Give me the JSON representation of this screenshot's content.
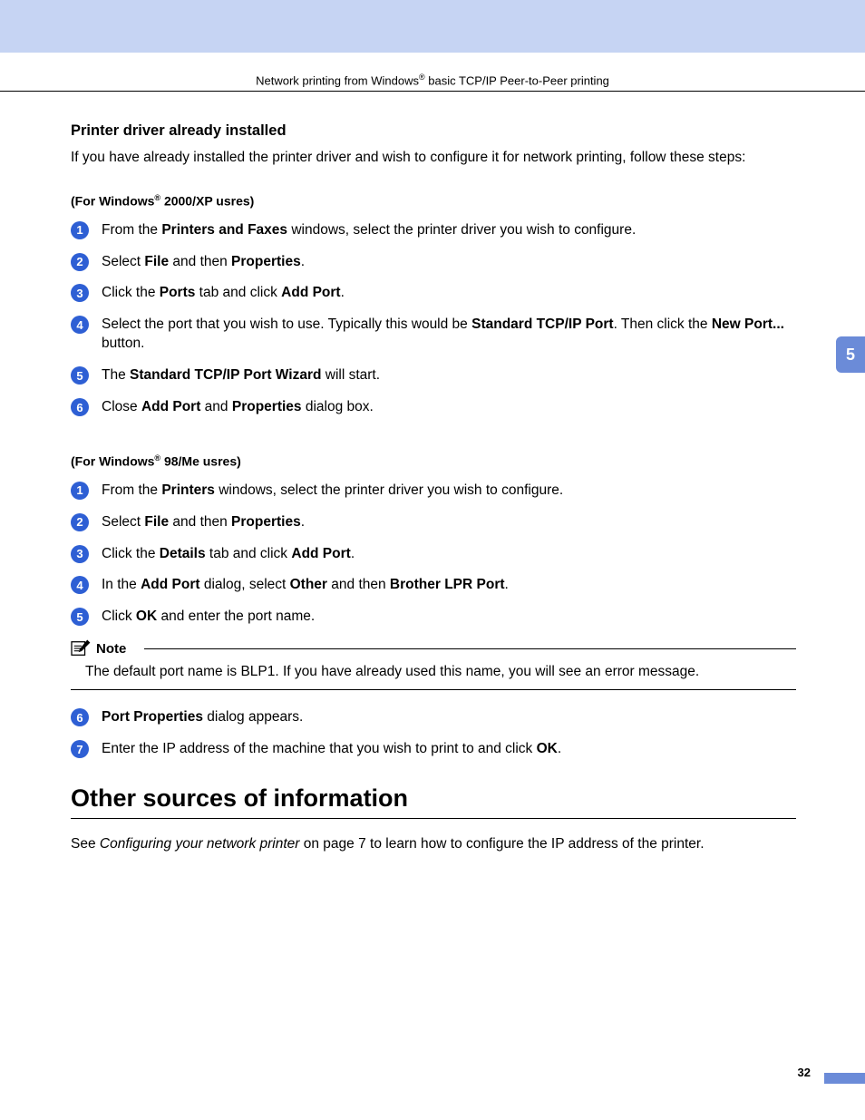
{
  "header": {
    "before_reg": "Network printing from Windows",
    "after_reg": " basic TCP/IP Peer-to-Peer printing"
  },
  "side_tab": "5",
  "page_number": "32",
  "section": {
    "title": "Printer driver already installed",
    "intro": "If you have already installed the printer driver and wish to configure it for network printing, follow these steps:"
  },
  "group_a": {
    "subhead_before": "(For Windows",
    "subhead_after": " 2000/XP usres)",
    "steps": [
      {
        "n": "1",
        "segments": [
          {
            "t": "From the "
          },
          {
            "t": "Printers and Faxes",
            "b": true
          },
          {
            "t": " windows, select the printer driver you wish to configure."
          }
        ]
      },
      {
        "n": "2",
        "segments": [
          {
            "t": "Select "
          },
          {
            "t": "File",
            "b": true
          },
          {
            "t": " and then "
          },
          {
            "t": "Properties",
            "b": true
          },
          {
            "t": "."
          }
        ]
      },
      {
        "n": "3",
        "segments": [
          {
            "t": "Click the "
          },
          {
            "t": "Ports",
            "b": true
          },
          {
            "t": " tab and click "
          },
          {
            "t": "Add Port",
            "b": true
          },
          {
            "t": "."
          }
        ]
      },
      {
        "n": "4",
        "segments": [
          {
            "t": "Select the port that you wish to use. Typically this would be "
          },
          {
            "t": "Standard TCP/IP Port",
            "b": true
          },
          {
            "t": ". Then click the "
          },
          {
            "t": "New Port...",
            "b": true
          },
          {
            "t": " button."
          }
        ]
      },
      {
        "n": "5",
        "segments": [
          {
            "t": "The "
          },
          {
            "t": "Standard TCP/IP Port Wizard",
            "b": true
          },
          {
            "t": " will start."
          }
        ]
      },
      {
        "n": "6",
        "segments": [
          {
            "t": "Close "
          },
          {
            "t": "Add Port",
            "b": true
          },
          {
            "t": " and "
          },
          {
            "t": "Properties",
            "b": true
          },
          {
            "t": " dialog box."
          }
        ]
      }
    ]
  },
  "group_b": {
    "subhead_before": "(For Windows",
    "subhead_after": " 98/Me usres)",
    "steps_first": [
      {
        "n": "1",
        "segments": [
          {
            "t": "From the "
          },
          {
            "t": "Printers",
            "b": true
          },
          {
            "t": " windows, select the printer driver you wish to configure."
          }
        ]
      },
      {
        "n": "2",
        "segments": [
          {
            "t": "Select "
          },
          {
            "t": "File",
            "b": true
          },
          {
            "t": " and then "
          },
          {
            "t": "Properties",
            "b": true
          },
          {
            "t": "."
          }
        ]
      },
      {
        "n": "3",
        "segments": [
          {
            "t": "Click the "
          },
          {
            "t": "Details",
            "b": true
          },
          {
            "t": " tab and click "
          },
          {
            "t": "Add Port",
            "b": true
          },
          {
            "t": "."
          }
        ]
      },
      {
        "n": "4",
        "segments": [
          {
            "t": "In the "
          },
          {
            "t": "Add Port",
            "b": true
          },
          {
            "t": " dialog, select "
          },
          {
            "t": "Other",
            "b": true
          },
          {
            "t": " and then "
          },
          {
            "t": "Brother LPR Port",
            "b": true
          },
          {
            "t": "."
          }
        ]
      },
      {
        "n": "5",
        "segments": [
          {
            "t": "Click "
          },
          {
            "t": "OK",
            "b": true
          },
          {
            "t": " and enter the port name."
          }
        ]
      }
    ],
    "note": {
      "label": "Note",
      "body": "The default port name is BLP1. If you have already used this name, you will see an error message."
    },
    "steps_rest": [
      {
        "n": "6",
        "segments": [
          {
            "t": "Port Properties",
            "b": true
          },
          {
            "t": " dialog appears."
          }
        ]
      },
      {
        "n": "7",
        "segments": [
          {
            "t": "Enter the IP address of the machine that you wish to print to and click "
          },
          {
            "t": "OK",
            "b": true
          },
          {
            "t": "."
          }
        ]
      }
    ]
  },
  "other_sources": {
    "heading": "Other sources of information",
    "see_before": "See ",
    "see_italic": "Configuring your network printer",
    "see_after": " on page 7 to learn how to configure the IP address of the printer."
  }
}
